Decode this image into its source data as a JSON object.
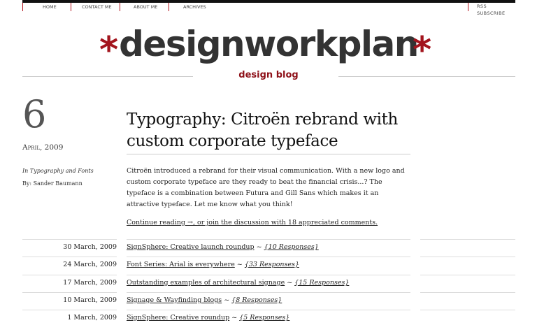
{
  "nav": {
    "items": [
      "HOME",
      "CONTACT ME",
      "ABOUT ME",
      "ARCHIVES"
    ],
    "rss": "RSS SUBSCRIBE"
  },
  "header": {
    "star": "*",
    "logo": "designworkplan",
    "tagline": "design blog"
  },
  "post": {
    "day": "6",
    "month_year": "April, 2009",
    "category": "In Typography and Fonts",
    "author": "By: Sander Baumann",
    "title": "Typography: Citroën rebrand with custom corporate typeface",
    "excerpt": "Citroën introduced a rebrand for their visual communication. With a new logo and custom corporate typeface are they ready to beat the financial crisis...? The typeface is a combination between Futura and Gill Sans which makes it an attractive typeface. Let me know what you think!",
    "continue": "Continue reading →, or join the discussion with 18 appreciated comments."
  },
  "recent": [
    {
      "date": "30 March, 2009",
      "title": "SignSphere: Creative launch roundup",
      "sep": " ~ ",
      "responses": "{10 Responses}"
    },
    {
      "date": "24 March, 2009",
      "title": "Font Series: Arial is everywhere",
      "sep": " ~ ",
      "responses": "{33 Responses}"
    },
    {
      "date": "17 March, 2009",
      "title": "Outstanding examples of architectural signage",
      "sep": " ~ ",
      "responses": "{15 Responses}"
    },
    {
      "date": "10 March, 2009",
      "title": "Signage & Wayfinding blogs",
      "sep": " ~ ",
      "responses": "{8 Responses}"
    },
    {
      "date": "1 March, 2009",
      "title": "SignSphere: Creative roundup",
      "sep": " ~ ",
      "responses": "{5 Responses}"
    }
  ],
  "colors": {
    "accent": "#a3141d",
    "text": "#222222",
    "rule": "#cccccc"
  }
}
